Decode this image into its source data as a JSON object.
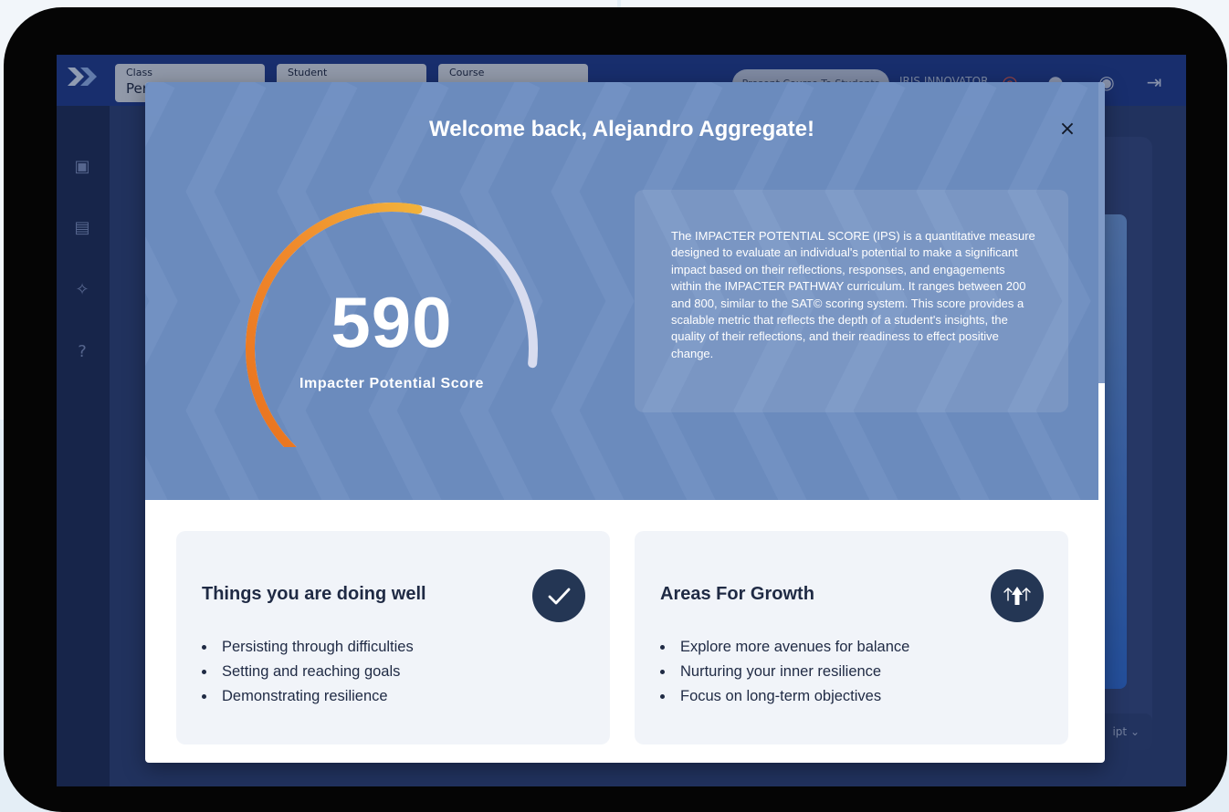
{
  "app": {
    "selectors": [
      {
        "label": "Class",
        "value": "Per"
      },
      {
        "label": "Student",
        "value": ""
      },
      {
        "label": "Course",
        "value": ""
      }
    ],
    "present_button": "Present Course To Students",
    "user_name": "IRIS INNOVATOR",
    "behind_dropdown": "ipt"
  },
  "modal": {
    "title": "Welcome back, Alejandro Aggregate!",
    "close_label": "×",
    "score": {
      "value": "590",
      "label": "Impacter Potential Score",
      "min": 200,
      "max": 800,
      "colors": {
        "start": "#e8701d",
        "end": "#f2b23a",
        "track": "#d8dcef"
      }
    },
    "description": "The IMPACTER POTENTIAL SCORE (IPS) is a quantitative measure designed to evaluate an individual's potential to make a significant impact based on their reflections, responses, and engagements within the IMPACTER PATHWAY curriculum. It ranges between 200 and 800, similar to the SAT© scoring system. This score provides a scalable metric that reflects the depth of a student's insights, the quality of their reflections, and their readiness to effect positive change.",
    "strengths": {
      "title": "Things you are doing well",
      "icon": "check-icon",
      "items": [
        "Persisting through difficulties",
        "Setting and reaching goals",
        "Demonstrating resilience"
      ]
    },
    "growth": {
      "title": "Areas For Growth",
      "icon": "growth-arrows-icon",
      "items": [
        "Explore more avenues for balance",
        "Nurturing your inner resilience",
        "Focus on long-term objectives"
      ]
    }
  },
  "colors": {
    "hero": "#6b8bbd",
    "card": "#f1f4f9",
    "badge": "#243654",
    "text_dark": "#1f2a44"
  }
}
